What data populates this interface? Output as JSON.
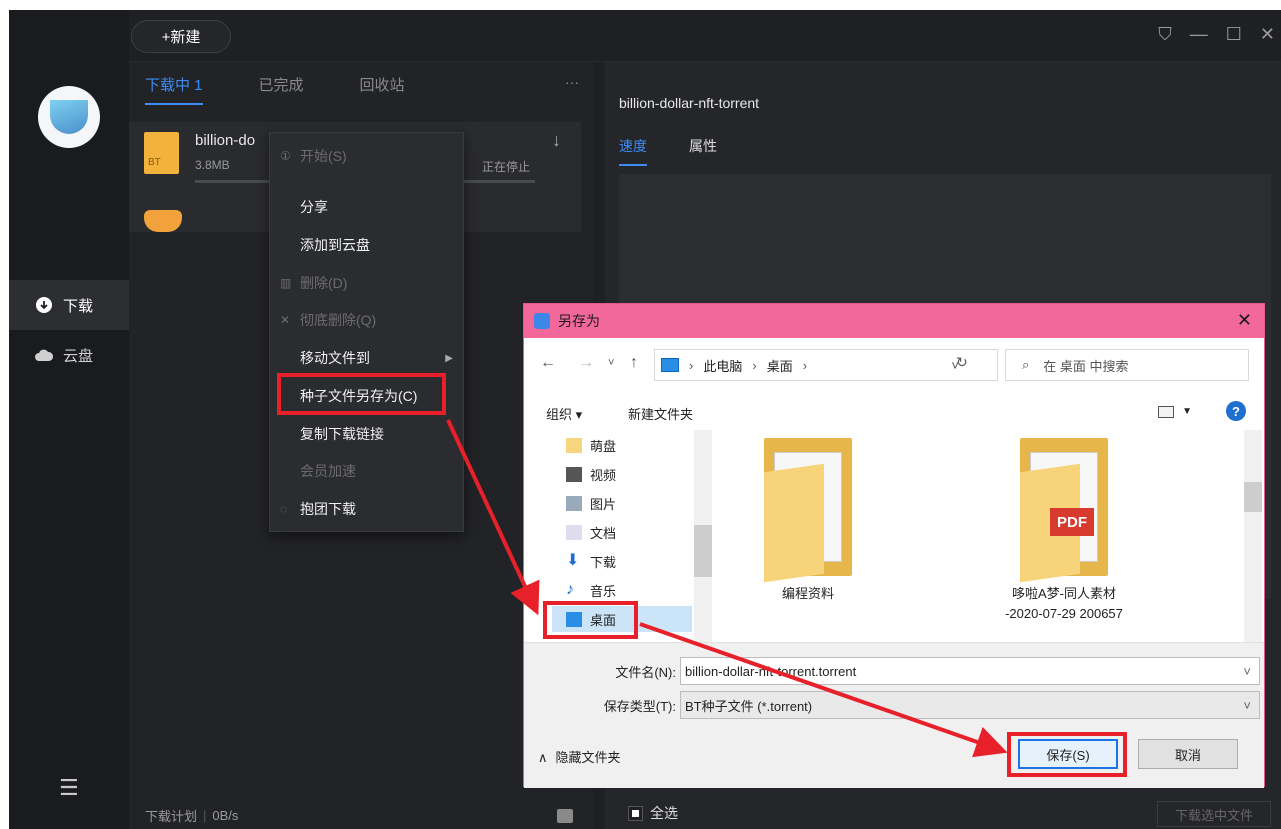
{
  "app": {
    "new_button": "+新建",
    "nav": [
      {
        "label": "下载"
      },
      {
        "label": "云盘"
      }
    ],
    "tabs": [
      {
        "label": "下载中 1"
      },
      {
        "label": "已完成"
      },
      {
        "label": "回收站"
      }
    ],
    "more": "···",
    "task": {
      "name": "billion-do",
      "size": "3.8MB",
      "status": "正在停止",
      "icon_label": "BT"
    },
    "bottom": {
      "plan": "下载计划",
      "speed": "0B/s"
    },
    "detail": {
      "title": "billion-dollar-nft-torrent",
      "tabs": [
        {
          "label": "速度"
        },
        {
          "label": "属性"
        }
      ],
      "select_all": "全选",
      "download_selected": "下载选中文件"
    }
  },
  "context_menu": {
    "items": [
      {
        "label": "开始(S)",
        "disabled": true
      },
      {
        "label": "分享",
        "disabled": false
      },
      {
        "label": "添加到云盘",
        "disabled": false
      },
      {
        "label": "删除(D)",
        "disabled": true
      },
      {
        "label": "彻底删除(Q)",
        "disabled": true
      },
      {
        "label": "移动文件到",
        "disabled": false
      },
      {
        "label": "种子文件另存为(C)",
        "disabled": false
      },
      {
        "label": "复制下载链接",
        "disabled": false
      },
      {
        "label": "会员加速",
        "disabled": true
      },
      {
        "label": "抱团下载",
        "disabled": false
      }
    ]
  },
  "dialog": {
    "title": "另存为",
    "breadcrumb": [
      "此电脑",
      "桌面"
    ],
    "search_placeholder": "在 桌面 中搜索",
    "toolbar": {
      "organize": "组织 ▾",
      "new_folder": "新建文件夹"
    },
    "tree": [
      "萌盘",
      "视频",
      "图片",
      "文档",
      "下载",
      "音乐",
      "桌面"
    ],
    "files": [
      {
        "label": "编程资料",
        "type": "folder"
      },
      {
        "label": "哆啦A梦-同人素材\n-2020-07-29 200657",
        "type": "pdf-folder",
        "badge": "PDF"
      }
    ],
    "filename_label": "文件名(N):",
    "filename_value": "billion-dollar-nft-torrent.torrent",
    "filetype_label": "保存类型(T):",
    "filetype_value": "BT种子文件 (*.torrent)",
    "hide_folders": "隐藏文件夹",
    "save_button": "保存(S)",
    "cancel_button": "取消"
  },
  "colors": {
    "accent": "#3d8cf2",
    "annotation": "#e8202a",
    "dialog_title": "#f2689a"
  }
}
